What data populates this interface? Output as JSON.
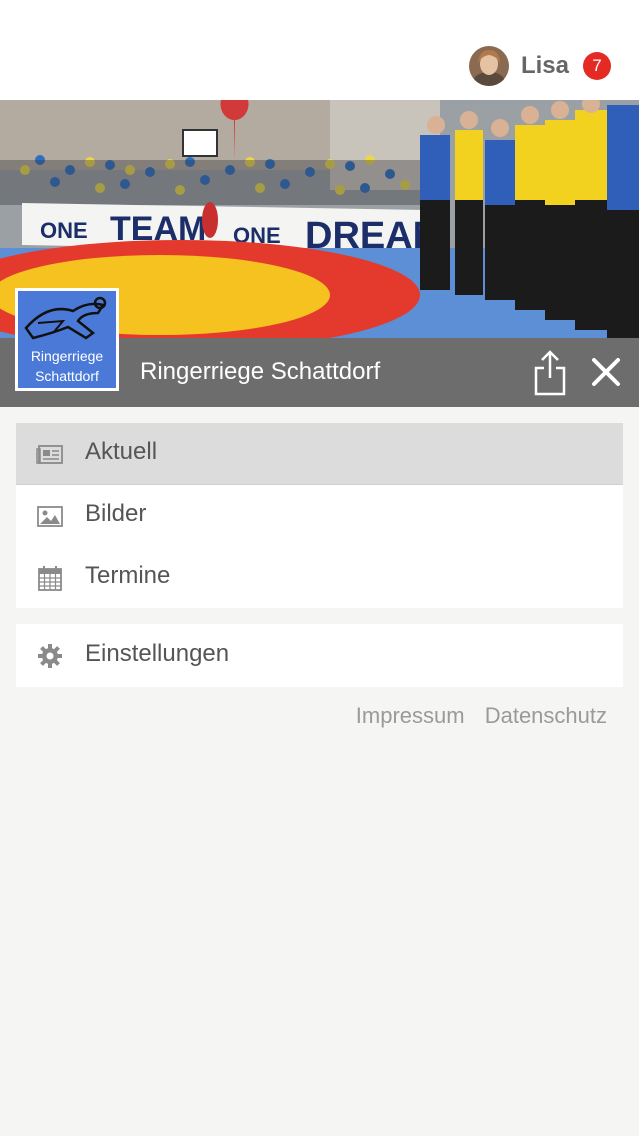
{
  "header": {
    "user_name": "Lisa",
    "notification_count": "7"
  },
  "hero": {
    "banner_text": [
      "ONE",
      "TEAM",
      "ONE",
      "DREAM"
    ]
  },
  "club": {
    "name": "Ringerriege Schattdorf",
    "logo_text_line1": "Ringerriege",
    "logo_text_line2": "Schattdorf"
  },
  "menu": {
    "items": [
      {
        "label": "Aktuell",
        "icon": "newspaper-icon"
      },
      {
        "label": "Bilder",
        "icon": "image-icon"
      },
      {
        "label": "Termine",
        "icon": "calendar-icon"
      }
    ],
    "settings": {
      "label": "Einstellungen",
      "icon": "gear-icon"
    }
  },
  "footer": {
    "impressum": "Impressum",
    "datenschutz": "Datenschutz"
  },
  "colors": {
    "badge": "#e52a24",
    "titlebar": "#6d6d6d",
    "active_item": "#dcdcdc",
    "logo_bg": "#4b79d8"
  }
}
